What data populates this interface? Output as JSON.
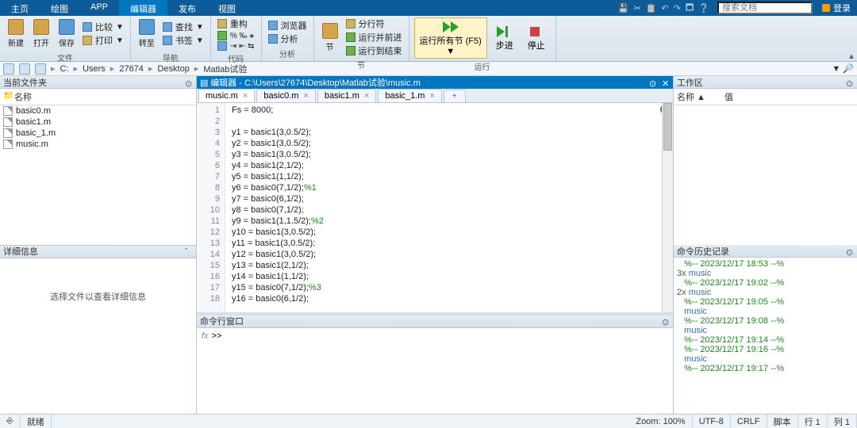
{
  "menu": {
    "tabs": [
      "主页",
      "绘图",
      "APP",
      "编辑器",
      "发布",
      "视图"
    ],
    "active": 3,
    "search_ph": "搜索文档",
    "login": "登录"
  },
  "toolstrip": {
    "groups": [
      {
        "label": "文件",
        "items": [
          "新建",
          "打开",
          "保存"
        ],
        "extra": [
          "比较",
          "打印"
        ]
      },
      {
        "label": "导航",
        "items": [
          "转至"
        ],
        "extra": [
          "查找",
          "书签"
        ]
      },
      {
        "label": "代码",
        "extra": [
          "重构",
          "%",
          "缩进"
        ]
      },
      {
        "label": "分析",
        "items": [
          "浏览器",
          "分析"
        ]
      },
      {
        "label": "节",
        "extra": [
          "分行符",
          "运行并前进",
          "运行到结束"
        ]
      },
      {
        "label": "运行",
        "run": "运行所有节 (F5)",
        "items": [
          "运行",
          "步进",
          "停止"
        ]
      }
    ]
  },
  "address": {
    "segs": [
      "C:",
      "Users",
      "27674",
      "Desktop",
      "Matlab试验"
    ]
  },
  "panels": {
    "cur_folder": {
      "title": "当前文件夹",
      "col": "名称",
      "files": [
        "basic0.m",
        "basic1.m",
        "basic_1.m",
        "music.m"
      ]
    },
    "details": {
      "title": "详细信息",
      "msg": "选择文件以查看详细信息"
    },
    "editor": {
      "title": "编辑器 - C:\\Users\\27674\\Desktop\\Matlab试验\\music.m",
      "tabs": [
        "music.m",
        "basic0.m",
        "basic1.m",
        "basic_1.m"
      ],
      "active": 0
    },
    "cmd": {
      "title": "命令行窗口",
      "prompt": ">>"
    },
    "ws": {
      "title": "工作区",
      "cols": [
        "名称 ▲",
        "值"
      ]
    },
    "hist": {
      "title": "命令历史记录",
      "entries": [
        {
          "c": "",
          "t": "%-- 2023/12/17 18:53 --%"
        },
        {
          "c": "3x",
          "m": "music"
        },
        {
          "c": "",
          "t": "%-- 2023/12/17 19:02 --%"
        },
        {
          "c": "2x",
          "m": "music"
        },
        {
          "c": "",
          "t": "%-- 2023/12/17 19:05 --%"
        },
        {
          "c": "",
          "m": "music"
        },
        {
          "c": "",
          "t": "%-- 2023/12/17 19:08 --%"
        },
        {
          "c": "",
          "m": "music"
        },
        {
          "c": "",
          "t": "%-- 2023/12/17 19:14 --%"
        },
        {
          "c": "",
          "t": "%-- 2023/12/17 19:16 --%"
        },
        {
          "c": "",
          "m": "music"
        },
        {
          "c": "",
          "t": "%-- 2023/12/17 19:17 --%"
        }
      ]
    }
  },
  "code": {
    "lines": [
      "Fs = 8000;",
      "",
      "y1 = basic1(3,0.5/2);",
      "y2 = basic1(3,0.5/2);",
      "y3 = basic1(3,0.5/2);",
      "y4 = basic1(2,1/2);",
      "y5 = basic1(1,1/2);",
      "y6 = basic0(7,1/2);%1",
      "y7 = basic0(6,1/2);",
      "y8 = basic0(7,1/2);",
      "y9 = basic1(1,1.5/2);%2",
      "y10 = basic1(3,0.5/2);",
      "y11 = basic1(3,0.5/2);",
      "y12 = basic1(3,0.5/2);",
      "y13 = basic1(2,1/2);",
      "y14 = basic1(1,1/2);",
      "y15 = basic0(7,1/2);%3",
      "y16 = basic0(6,1/2);"
    ]
  },
  "status": {
    "ready": "就绪",
    "zoom": "Zoom: 100%",
    "enc": "UTF-8",
    "eol": "CRLF",
    "mode": "脚本",
    "line": "行 1",
    "col": "列 1"
  }
}
